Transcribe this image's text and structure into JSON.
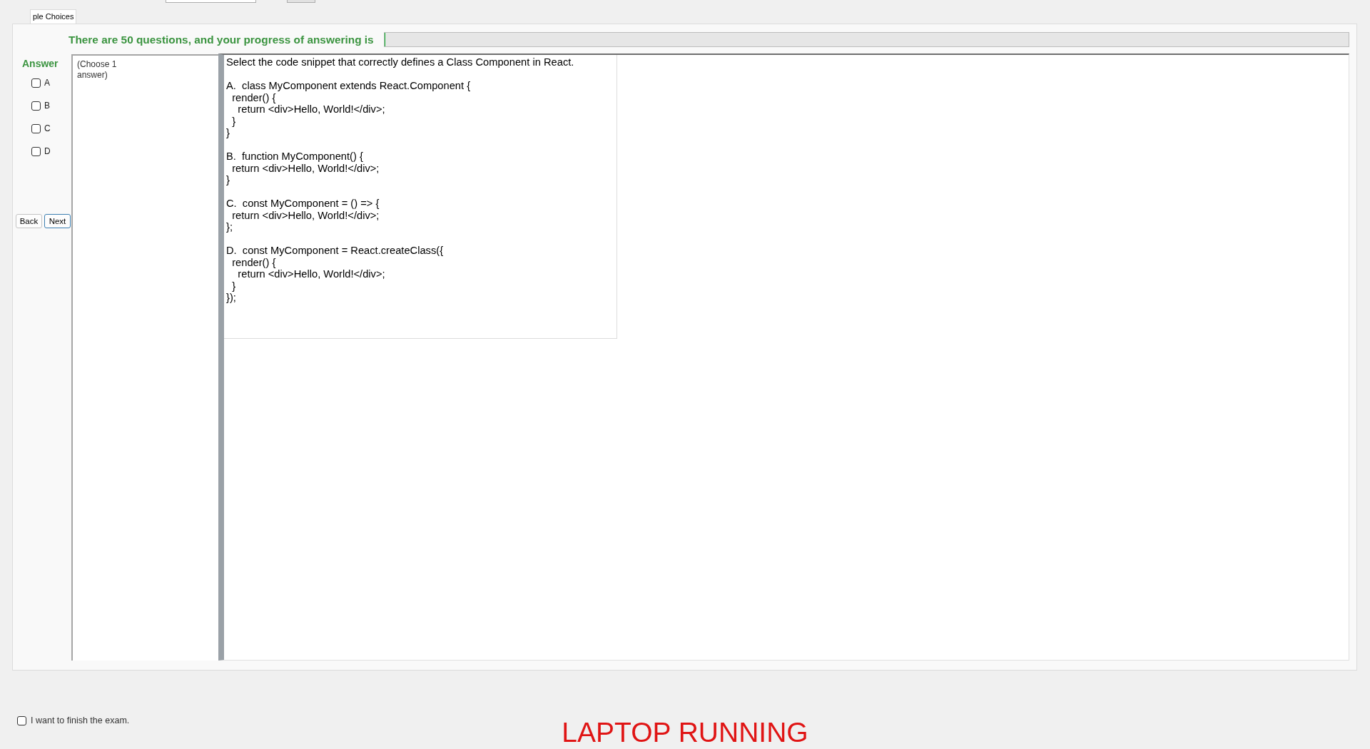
{
  "tabs": [
    {
      "label": "ple Choices",
      "selected": true
    }
  ],
  "progress": {
    "text": "There are 50 questions, and your progress of answering is",
    "level": 0
  },
  "answer_panel": {
    "title": "Answer",
    "options": [
      {
        "label": "A",
        "checked": false
      },
      {
        "label": "B",
        "checked": false
      },
      {
        "label": "C",
        "checked": false
      },
      {
        "label": "D",
        "checked": false
      }
    ]
  },
  "navigation": [
    {
      "label": "Back",
      "focused": false
    },
    {
      "label": "Next",
      "focused": true
    }
  ],
  "instruction": "(Choose 1 answer)",
  "question": {
    "prompt": "Select the code snippet that correctly defines a Class Component in React.",
    "options": [
      "A.  class MyComponent extends React.Component {\n  render() {\n    return <div>Hello, World!</div>;\n  }\n}",
      "B.  function MyComponent() {\n  return <div>Hello, World!</div>;\n}",
      "C.  const MyComponent = () => {\n  return <div>Hello, World!</div>;\n};",
      "D.  const MyComponent = React.createClass({\n  render() {\n    return <div>Hello, World!</div>;\n  }\n});"
    ]
  },
  "finish": {
    "label": "I want to finish the exam.",
    "checked": false
  },
  "status": "LAPTOP RUNNING"
}
